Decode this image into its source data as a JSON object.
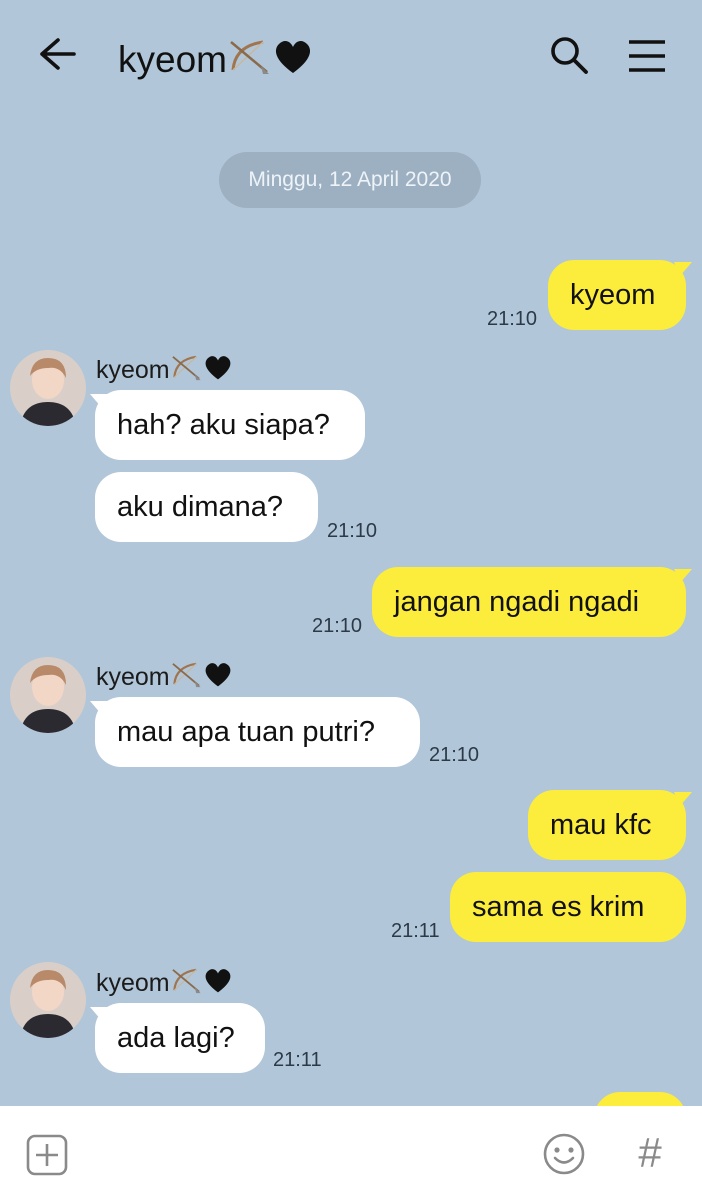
{
  "header": {
    "title": "kyeom",
    "back_icon": "arrow-left-icon",
    "search_icon": "search-icon",
    "menu_icon": "hamburger-menu-icon"
  },
  "date_separator": "Minggu, 12 April 2020",
  "contact": {
    "name": "kyeom",
    "name_emojis": [
      "bow-and-arrow-emoji",
      "black-heart-emoji"
    ]
  },
  "messages": [
    {
      "side": "me",
      "text": "kyeom",
      "time": "21:10"
    },
    {
      "side": "them",
      "text": "hah? aku siapa?",
      "time": ""
    },
    {
      "side": "them",
      "text": "aku dimana?",
      "time": "21:10"
    },
    {
      "side": "me",
      "text": "jangan ngadi ngadi",
      "time": "21:10"
    },
    {
      "side": "them",
      "text": "mau apa tuan putri?",
      "time": "21:10"
    },
    {
      "side": "me",
      "text": "mau kfc",
      "time": ""
    },
    {
      "side": "me",
      "text": "sama es krim",
      "time": "21:11"
    },
    {
      "side": "them",
      "text": "ada lagi?",
      "time": "21:11"
    }
  ],
  "colors": {
    "background": "#b1c6d9",
    "my_bubble": "#fcec3c",
    "their_bubble": "#ffffff",
    "date_pill": "#9db0c2"
  },
  "bottom_bar": {
    "plus_icon": "add-attachment-icon",
    "emoji_icon": "emoji-smiley-icon",
    "hash_label": "#"
  }
}
